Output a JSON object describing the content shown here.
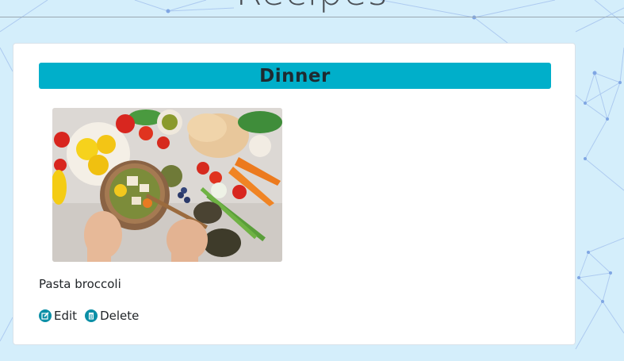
{
  "page": {
    "title": "Recipes"
  },
  "section": {
    "title": "Dinner"
  },
  "recipe": {
    "image_alt": "Bowl of vegetables with fresh produce",
    "name": "Pasta broccoli"
  },
  "actions": {
    "edit_label": "Edit",
    "delete_label": "Delete"
  },
  "colors": {
    "background": "#d4eefb",
    "header_accent": "#00afca",
    "icon_teal": "#0b8fa6"
  },
  "icons": [
    "edit-icon",
    "trash-icon"
  ]
}
